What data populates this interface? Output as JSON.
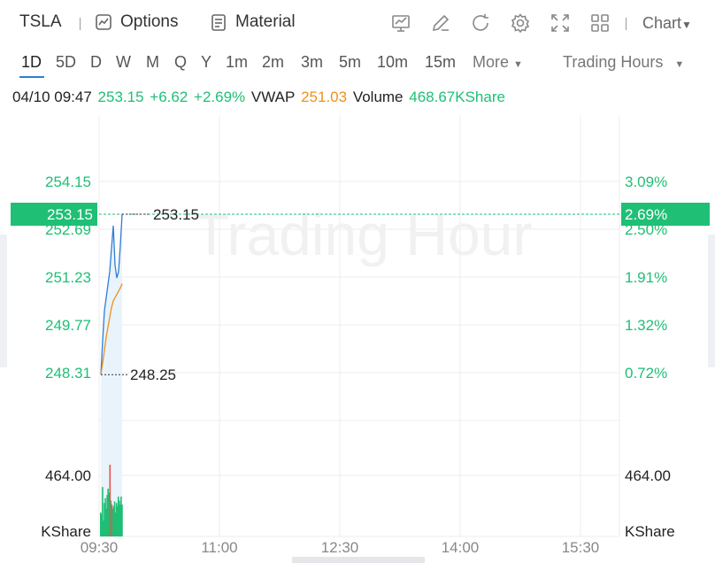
{
  "toolbar": {
    "symbol": "TSLA",
    "options_label": "Options",
    "material_label": "Material",
    "chart_label": "Chart",
    "icons": [
      "indicator-icon",
      "draw-icon",
      "refresh-icon",
      "settings-icon",
      "fullscreen-icon",
      "layout-icon"
    ]
  },
  "timeframes": [
    "1D",
    "5D",
    "D",
    "W",
    "M",
    "Q",
    "Y",
    "1m",
    "2m",
    "3m",
    "5m",
    "10m",
    "15m"
  ],
  "active_timeframe": "1D",
  "more_label": "More",
  "trading_hours_label": "Trading Hours",
  "quote": {
    "datetime": "04/10 09:47",
    "price": "253.15",
    "change": "+6.62",
    "change_pct": "+2.69%",
    "vwap_label": "VWAP",
    "vwap": "251.03",
    "volume_label": "Volume",
    "volume": "468.67KShare"
  },
  "watermark": "Trading Hour",
  "colors": {
    "up": "#1fbf75",
    "vwap": "#f0901a",
    "price_line": "#2e7dd7",
    "grid": "#ececec"
  },
  "chart_data": {
    "type": "line",
    "x_ticks": [
      "09:30",
      "11:00",
      "12:30",
      "14:00",
      "15:30"
    ],
    "price_axis": [
      "254.15",
      "252.69",
      "251.23",
      "249.77",
      "248.31"
    ],
    "pct_axis": [
      "3.09%",
      "2.50%",
      "1.91%",
      "1.32%",
      "0.72%"
    ],
    "current_price_label": "253.15",
    "current_pct_label": "2.69%",
    "high_label": "253.15",
    "low_label": "248.25",
    "volume_axis_left": [
      "464.00",
      "KShare"
    ],
    "volume_axis_right": [
      "464.00",
      "KShare"
    ],
    "ylim": [
      248.31,
      254.15
    ],
    "series": [
      {
        "name": "Price",
        "values": [
          248.25,
          249.3,
          250.2,
          250.6,
          251.0,
          251.4,
          252.1,
          252.8,
          251.6,
          251.2,
          251.4,
          252.2,
          253.15
        ]
      },
      {
        "name": "VWAP",
        "values": [
          248.25,
          248.6,
          249.0,
          249.4,
          249.7,
          250.0,
          250.3,
          250.5,
          250.6,
          250.7,
          250.8,
          250.9,
          251.03
        ]
      }
    ],
    "volume": [
      30,
      28,
      62,
      20,
      42,
      48,
      35,
      52,
      60,
      55,
      90,
      45,
      40,
      35,
      38,
      44,
      30,
      42,
      38,
      50,
      45,
      40,
      50,
      40
    ]
  }
}
